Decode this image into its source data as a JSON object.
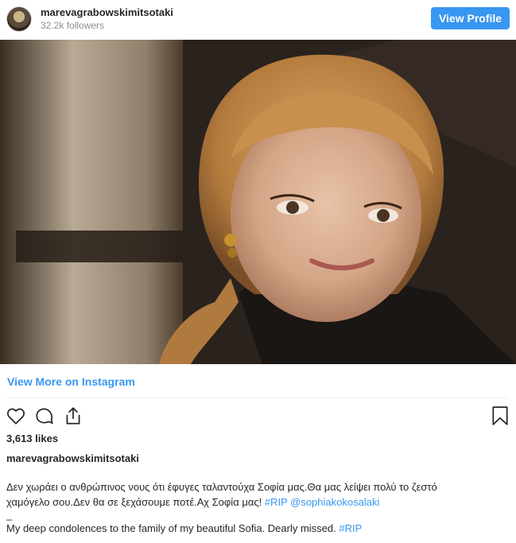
{
  "header": {
    "username": "marevagrabowskimitsotaki",
    "followers": "32.2k followers",
    "view_profile_label": "View Profile"
  },
  "post": {
    "view_more_label": "View More on Instagram",
    "likes": "3,613 likes",
    "caption_user": "marevagrabowskimitsotaki",
    "caption_line1": "Δεν χωράει ο ανθρώπινος νους ότι έφυγες ταλαντούχα Σοφία μας.Θα μας λείψει πολύ το ζεστό",
    "caption_line2": "χαμόγελο σου.Δεν θα σε ξεχάσουμε ποτέ.Αχ Σοφία μας! ",
    "tag_rip": "#RIP",
    "mention": "@sophiakokosalaki",
    "caption_dash": "_",
    "caption_en": "My deep condolences to the family of my beautiful Sofia. Dearly missed. ",
    "tag_rip2": "#RIP"
  },
  "colors": {
    "accent": "#3897f0",
    "text": "#262626",
    "muted": "#8e8e8e"
  },
  "icons": {
    "like": "heart-icon",
    "comment": "comment-icon",
    "share": "share-icon",
    "save": "bookmark-icon"
  }
}
